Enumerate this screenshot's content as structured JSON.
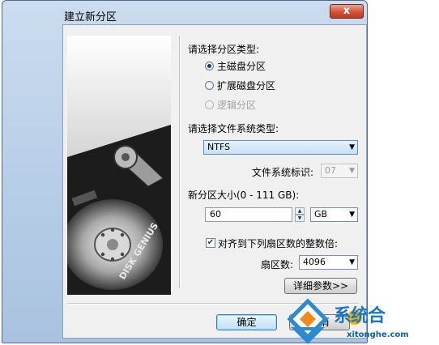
{
  "window": {
    "title": "建立新分区",
    "close_label": "x"
  },
  "partition_type": {
    "heading": "请选择分区类型:",
    "options": [
      {
        "label": "主磁盘分区",
        "checked": true,
        "disabled": false
      },
      {
        "label": "扩展磁盘分区",
        "checked": false,
        "disabled": false
      },
      {
        "label": "逻辑分区",
        "checked": false,
        "disabled": true
      }
    ]
  },
  "filesystem": {
    "heading": "请选择文件系统类型:",
    "selected": "NTFS",
    "id_label": "文件系统标识:",
    "id_value": "07"
  },
  "size": {
    "label": "新分区大小(0 - 111 GB):",
    "value": "60",
    "unit": "GB"
  },
  "align": {
    "checked": true,
    "label": "对齐到下列扇区数的整数倍:",
    "sectors_label": "扇区数:",
    "sectors_value": "4096"
  },
  "buttons": {
    "details": "详细参数>>",
    "ok": "确定",
    "cancel": "取消"
  },
  "image": {
    "brand_text": "DISK GENIUS"
  },
  "watermark": {
    "title": "系统合",
    "url": "xitonghe.com"
  },
  "colors": {
    "titlebar": "#b5cce6",
    "close_button": "#d2523b",
    "accent": "#1b76c0"
  }
}
